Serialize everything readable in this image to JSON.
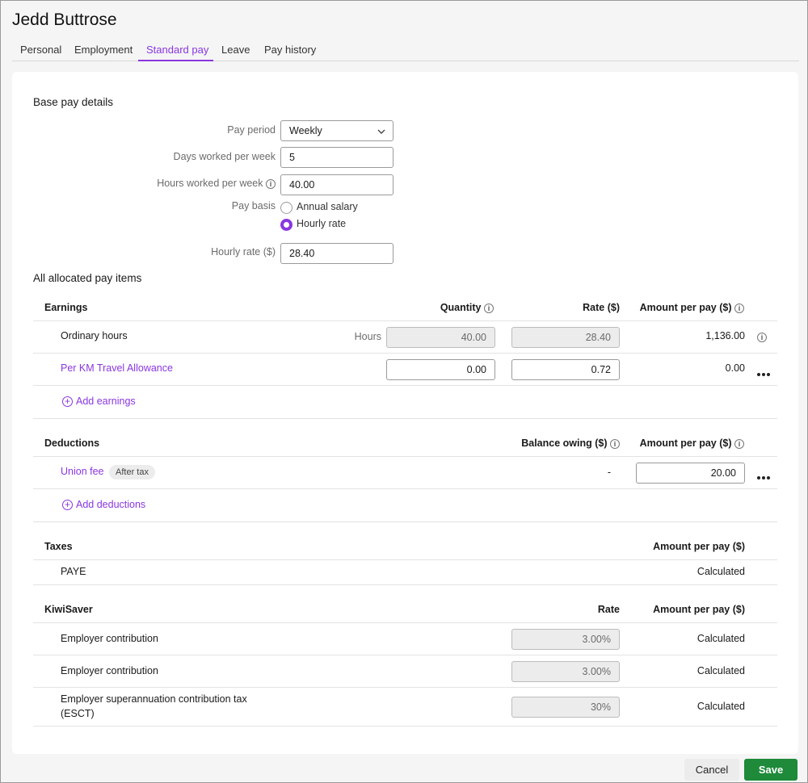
{
  "page": {
    "title": "Jedd Buttrose",
    "tabs": [
      "Personal",
      "Employment",
      "Standard pay",
      "Leave",
      "Pay history"
    ],
    "active_tab": "Standard pay"
  },
  "base_pay": {
    "heading": "Base pay details",
    "pay_period_label": "Pay period",
    "pay_period_value": "Weekly",
    "days_label": "Days worked per week",
    "days_value": "5",
    "hours_label": "Hours worked per week",
    "hours_value": "40.00",
    "pay_basis_label": "Pay basis",
    "pay_basis_options": [
      "Annual salary",
      "Hourly rate"
    ],
    "pay_basis_selected": "Hourly rate",
    "hourly_rate_label": "Hourly rate ($)",
    "hourly_rate_value": "28.40"
  },
  "pay_items": {
    "heading": "All allocated pay items",
    "earnings": {
      "heading": "Earnings",
      "col_quantity": "Quantity",
      "col_rate": "Rate ($)",
      "col_amount": "Amount per pay ($)",
      "rows": [
        {
          "name": "Ordinary hours",
          "unit": "Hours",
          "quantity": "40.00",
          "rate": "28.40",
          "amount": "1,136.00"
        },
        {
          "name": "Per KM Travel Allowance",
          "quantity": "0.00",
          "rate": "0.72",
          "amount": "0.00"
        }
      ],
      "add_label": "Add earnings"
    },
    "deductions": {
      "heading": "Deductions",
      "col_balance": "Balance owing ($)",
      "col_amount": "Amount per pay ($)",
      "rows": [
        {
          "name": "Union fee",
          "badge": "After tax",
          "balance": "-",
          "amount": "20.00"
        }
      ],
      "add_label": "Add deductions"
    },
    "taxes": {
      "heading": "Taxes",
      "col_amount": "Amount per pay ($)",
      "rows": [
        {
          "name": "PAYE",
          "amount": "Calculated"
        }
      ]
    },
    "kiwisaver": {
      "heading": "KiwiSaver",
      "col_rate": "Rate",
      "col_amount": "Amount per pay ($)",
      "rows": [
        {
          "name": "Employer contribution",
          "rate": "3.00%",
          "amount": "Calculated"
        },
        {
          "name": "Employer contribution",
          "rate": "3.00%",
          "amount": "Calculated"
        },
        {
          "name_line1": "Employer superannuation contribution tax",
          "name_line2": "(ESCT)",
          "rate": "30%",
          "amount": "Calculated"
        }
      ]
    }
  },
  "footer": {
    "cancel_label": "Cancel",
    "save_label": "Save"
  },
  "colors": {
    "accent": "#8a36e0",
    "save": "#1e8a3a"
  }
}
